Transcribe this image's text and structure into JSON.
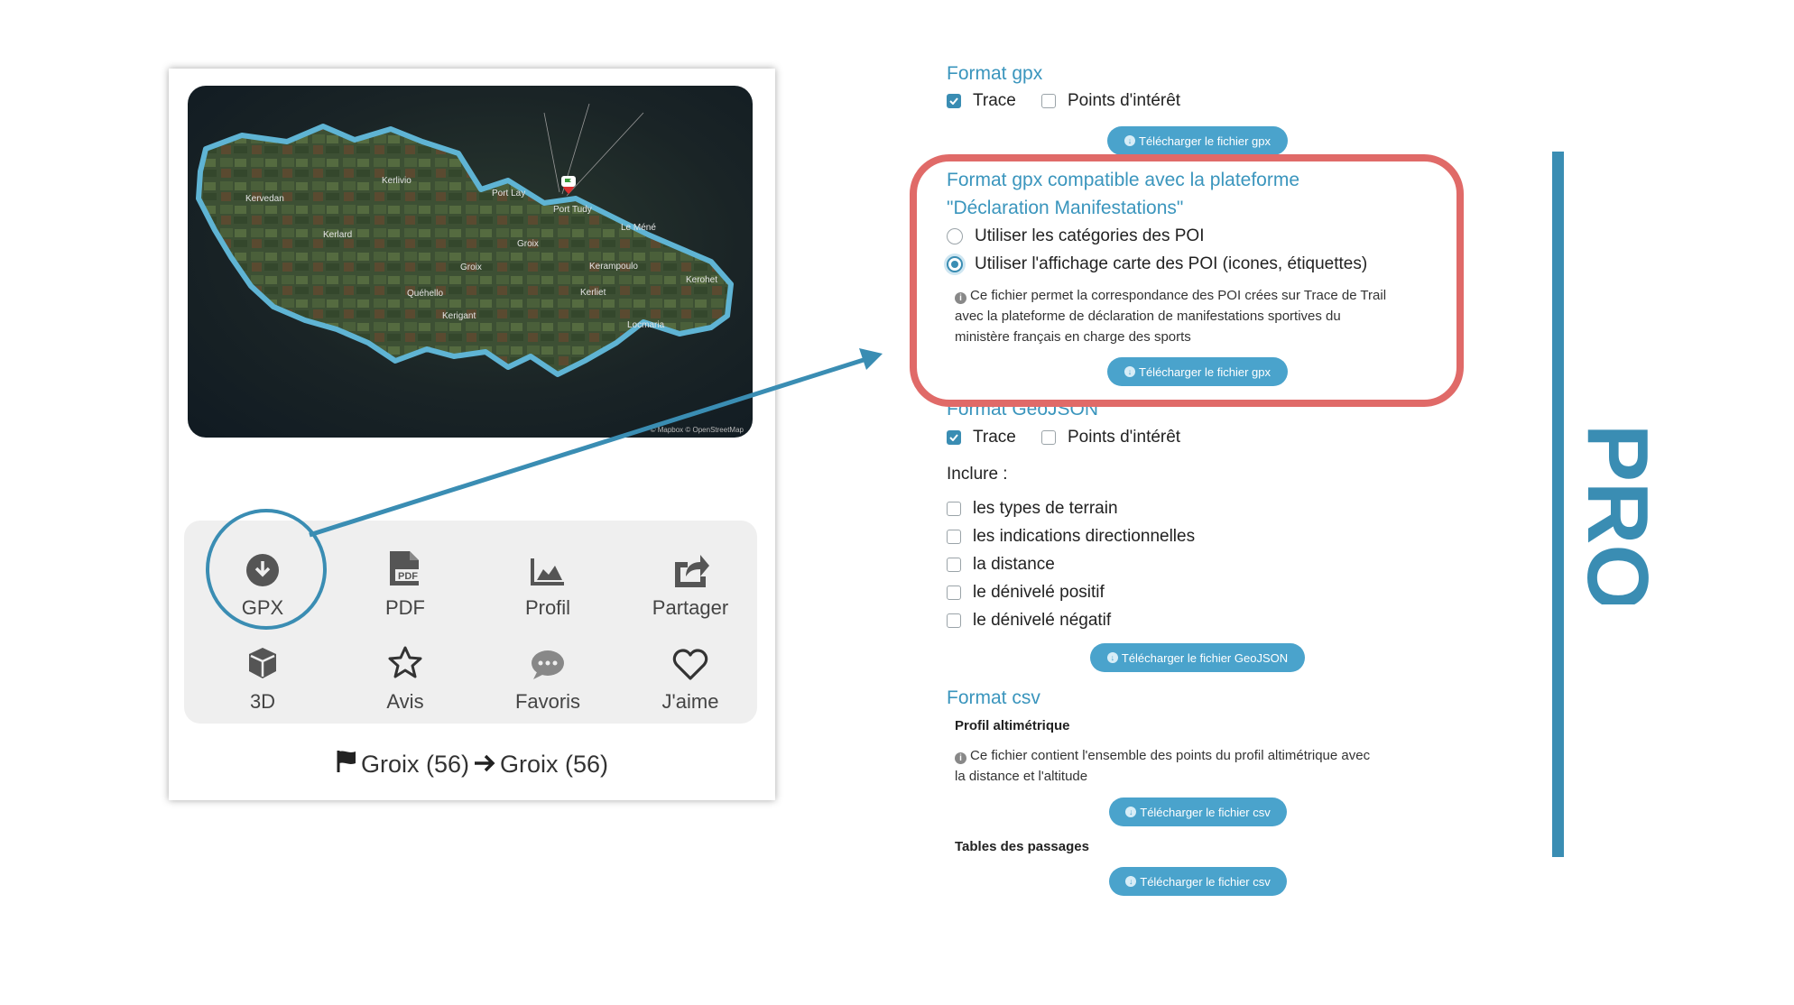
{
  "card": {
    "map_places": [
      "Kervedan",
      "Kerlivio",
      "Port Lay",
      "Port Tudy",
      "Kerlard",
      "Groix",
      "Le Méné",
      "Groix",
      "Kerampoulo",
      "Kerohet",
      "Quéhello",
      "Kerliet",
      "Kerigant",
      "Locmaria"
    ],
    "map_attribution": "© Mapbox © OpenStreetMap",
    "actions": [
      {
        "label": "GPX",
        "icon": "download-circle-icon"
      },
      {
        "label": "PDF",
        "icon": "pdf-file-icon",
        "icon_text": "PDF"
      },
      {
        "label": "Profil",
        "icon": "area-chart-icon"
      },
      {
        "label": "Partager",
        "icon": "share-icon"
      },
      {
        "label": "3D",
        "icon": "cube-icon"
      },
      {
        "label": "Avis",
        "icon": "star-icon"
      },
      {
        "label": "Favoris",
        "icon": "chat-bubble-icon"
      },
      {
        "label": "J'aime",
        "icon": "heart-icon"
      }
    ],
    "route": {
      "from": "Groix (56)",
      "to": "Groix (56)"
    }
  },
  "panel": {
    "gpx": {
      "title": "Format gpx",
      "trace_label": "Trace",
      "trace_checked": true,
      "poi_label": "Points d'intérêt",
      "poi_checked": false,
      "button": "Télécharger le fichier gpx"
    },
    "manif": {
      "title_line1": "Format gpx compatible avec la plateforme",
      "title_line2": "\"Déclaration Manifestations\"",
      "option1": "Utiliser les catégories des POI",
      "option2": "Utiliser l'affichage carte des POI (icones, étiquettes)",
      "selected": 2,
      "info_line1": "Ce fichier permet la correspondance des POI crées sur Trace de Trail",
      "info_line2": "avec la plateforme de déclaration de manifestations sportives du",
      "info_line3": "ministère français en charge des sports",
      "button": "Télécharger le fichier gpx"
    },
    "geojson": {
      "title": "Format GeoJSON",
      "trace_label": "Trace",
      "trace_checked": true,
      "poi_label": "Points d'intérêt",
      "poi_checked": false,
      "include_label": "Inclure :",
      "include": [
        "les types de terrain",
        "les indications directionnelles",
        "la distance",
        "le dénivelé positif",
        "le dénivelé négatif"
      ],
      "button": "Télécharger le fichier GeoJSON"
    },
    "csv": {
      "title": "Format csv",
      "profile_heading": "Profil altimétrique",
      "profile_info_line1": "Ce fichier contient l'ensemble des points du profil altimétrique avec",
      "profile_info_line2": "la distance et l'altitude",
      "profile_button": "Télécharger le fichier csv",
      "passages_heading": "Tables des passages",
      "passages_button": "Télécharger le fichier csv"
    }
  },
  "pro_label": "PRO",
  "colors": {
    "accent": "#3a8db3",
    "highlight": "#e06a68",
    "button": "#4aa3cc",
    "title": "#3a95bd"
  }
}
